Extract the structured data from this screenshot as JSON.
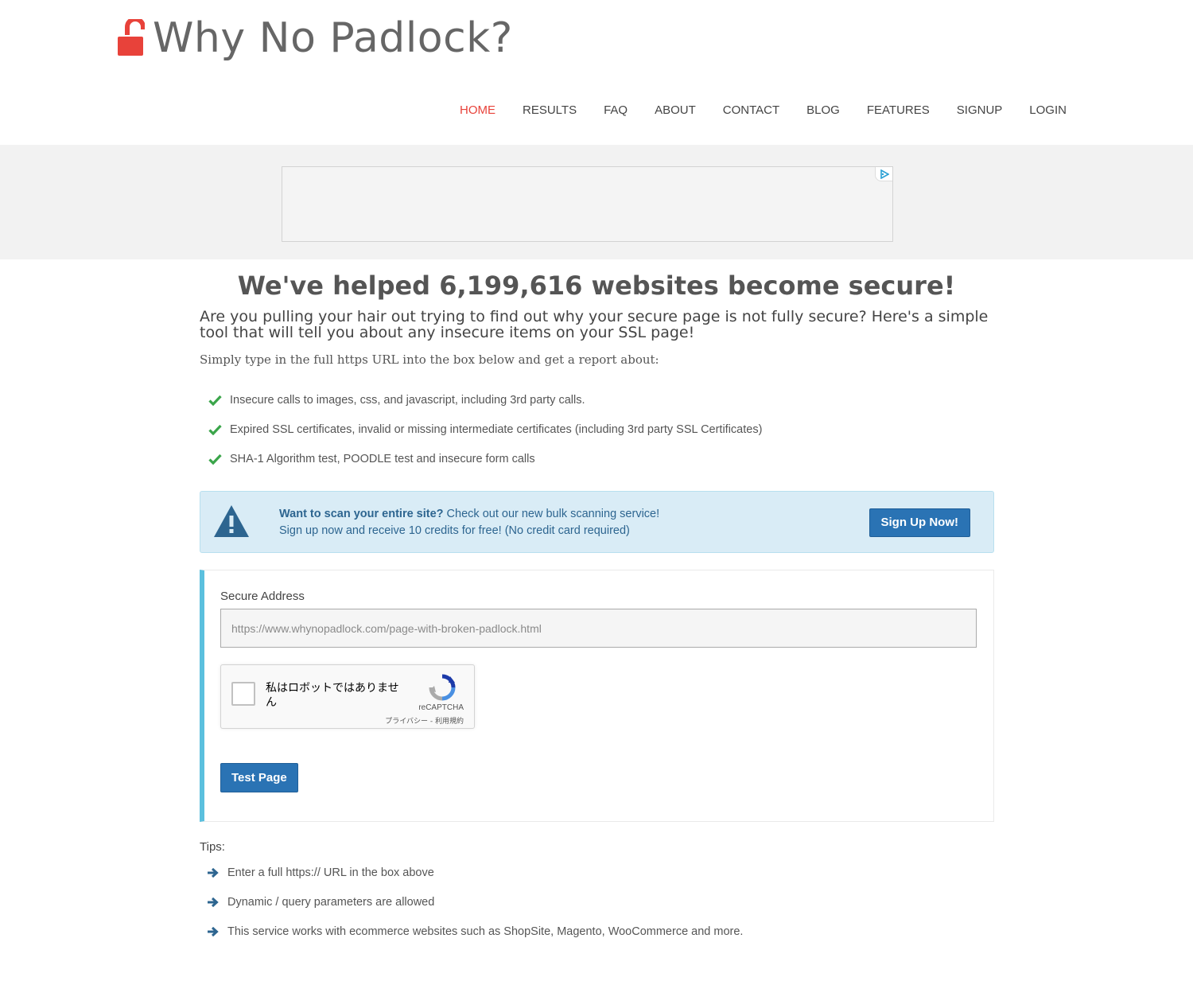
{
  "brand": {
    "logo_text": "Why No Padlock?",
    "accent_color": "#e8423a"
  },
  "nav": {
    "items": [
      {
        "label": "HOME",
        "active": true
      },
      {
        "label": "RESULTS",
        "active": false
      },
      {
        "label": "FAQ",
        "active": false
      },
      {
        "label": "ABOUT",
        "active": false
      },
      {
        "label": "CONTACT",
        "active": false
      },
      {
        "label": "BLOG",
        "active": false
      },
      {
        "label": "FEATURES",
        "active": false
      },
      {
        "label": "SIGNUP",
        "active": false
      },
      {
        "label": "LOGIN",
        "active": false
      }
    ]
  },
  "ad": {
    "badge_icon": "adchoices-icon"
  },
  "main": {
    "headline": "We've helped 6,199,616 websites become secure!",
    "subhead": "Are you pulling your hair out trying to find out why your secure page is not fully secure? Here's a simple tool that will tell you about any insecure items on your SSL page!",
    "intro": "Simply type in the full https URL into the box below and get a report about:",
    "features": [
      "Insecure calls to images, css, and javascript, including 3rd party calls.",
      "Expired SSL certificates, invalid or missing intermediate certificates (including 3rd party SSL Certificates)",
      "SHA-1 Algorithm test, POODLE test and insecure form calls"
    ],
    "feature_icon": "checkmark-icon",
    "feature_color": "#3aa54a"
  },
  "alert": {
    "icon": "warning-icon",
    "bold_text": "Want to scan your entire site?",
    "text": " Check out our new bulk scanning service!",
    "line2": "Sign up now and receive 10 credits for free! (No credit card required)",
    "button_label": "Sign Up Now!"
  },
  "form": {
    "label": "Secure Address",
    "placeholder": "https://www.whynopadlock.com/page-with-broken-padlock.html",
    "value": "",
    "recaptcha": {
      "label": "私はロボットではありません",
      "brand": "reCAPTCHA",
      "links": "プライバシー - 利用規約"
    },
    "submit_label": "Test Page"
  },
  "tips": {
    "title": "Tips:",
    "items": [
      "Enter a full https:// URL in the box above",
      "Dynamic / query parameters are allowed",
      "This service works with ecommerce websites such as ShopSite, Magento, WooCommerce and more."
    ],
    "icon": "arrow-right-icon"
  }
}
